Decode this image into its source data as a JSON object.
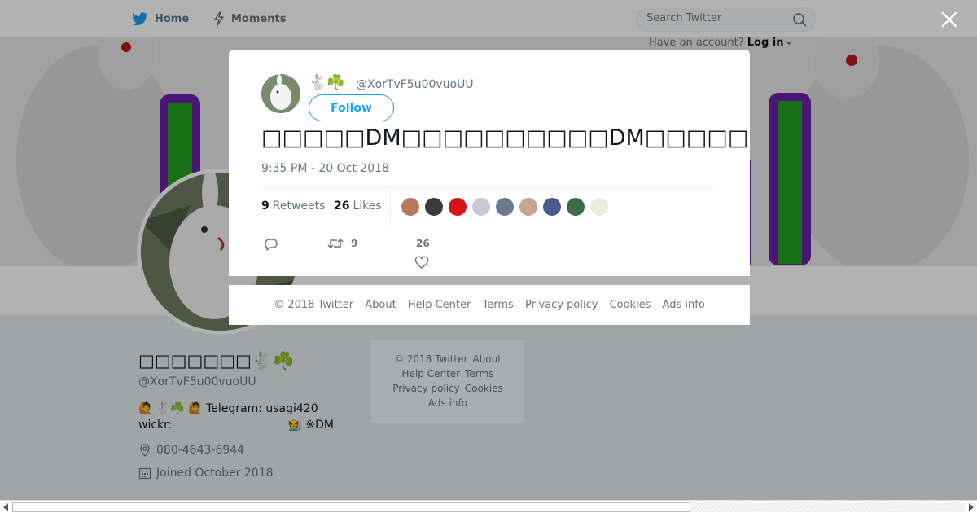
{
  "nav": {
    "home_label": "Home",
    "moments_label": "Moments",
    "search_placeholder": "Search Twitter",
    "account_prompt": "Have an account?",
    "login_label": "Log in"
  },
  "profile": {
    "name": "□□□□□□□🐇☘️",
    "handle": "@XorTvF5u00vuoUU",
    "bio_line1": "🙋 🐇☘️ 🙋 Telegram: usagi420",
    "bio_line2_left": "wickr:",
    "bio_line2_right": "🧑‍🌾 ※DM",
    "location": "080-4643-6944",
    "joined": "Joined October 2018"
  },
  "side_footer": {
    "line1": [
      "© 2018 Twitter",
      "About"
    ],
    "line2": [
      "Help Center",
      "Terms"
    ],
    "line3": [
      "Privacy policy",
      "Cookies"
    ],
    "line4": [
      "Ads info"
    ]
  },
  "tweet": {
    "display_emojis": "🐇☘️",
    "handle": "@XorTvF5u00vuoUU",
    "follow_label": "Follow",
    "text": "□□□□□DM□□□□□□□□□□DM□□□□□□□□□□□□□□□□□□□□□□□□□□□□□□Telegram□Wi",
    "timestamp": "9:35 PM - 20 Oct 2018",
    "retweets_count": "9",
    "retweets_label": "Retweets",
    "likes_count": "26",
    "likes_label": "Likes",
    "action_retweets": "9",
    "action_likes": "26",
    "liker_colors": [
      "#b67a5a",
      "#3a3a3a",
      "#d4141c",
      "#c9c9d6",
      "#6b7a8c",
      "#c8a38f",
      "#4a5a8a",
      "#3d6b4a",
      "#e8efe0"
    ]
  },
  "modal_footer": {
    "items": [
      "© 2018 Twitter",
      "About",
      "Help Center",
      "Terms",
      "Privacy policy",
      "Cookies",
      "Ads info"
    ]
  }
}
